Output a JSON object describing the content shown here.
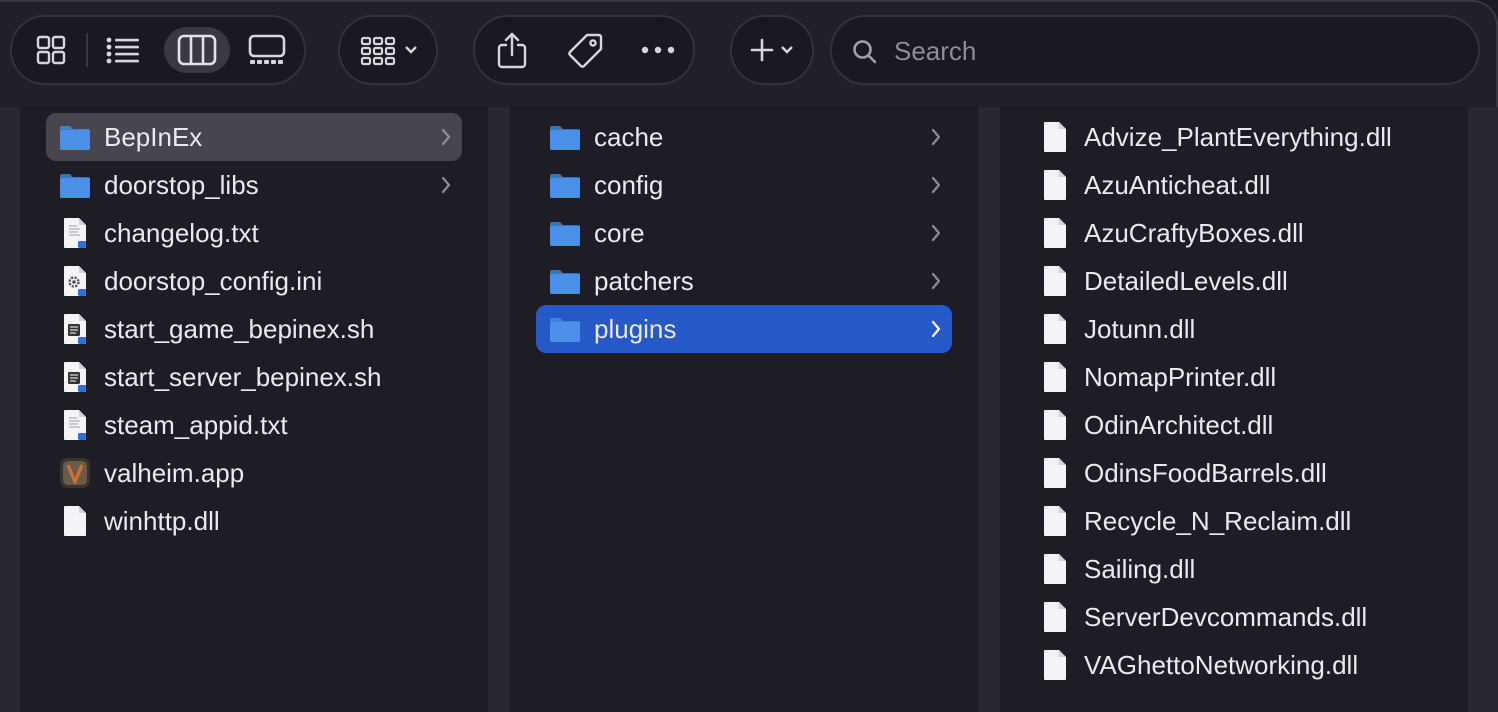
{
  "toolbar": {
    "view_buttons": [
      {
        "name": "icon-view",
        "icon": "grid-icon",
        "active": false
      },
      {
        "name": "list-view",
        "icon": "list-icon",
        "active": false
      },
      {
        "name": "column-view",
        "icon": "columns-icon",
        "active": true
      },
      {
        "name": "gallery-view",
        "icon": "gallery-icon",
        "active": false
      }
    ],
    "group_button": {
      "icon": "group-grid-icon",
      "chevron": "chevron-down-icon"
    },
    "action_buttons": [
      "share-icon",
      "tag-icon",
      "more-icon"
    ],
    "add_button": {
      "icon": "plus-icon",
      "chevron": "chevron-down-icon"
    },
    "search": {
      "placeholder": "Search",
      "value": ""
    }
  },
  "columns": [
    {
      "items": [
        {
          "label": "BepInEx",
          "kind": "folder",
          "has_children": true,
          "selected": "gray"
        },
        {
          "label": "doorstop_libs",
          "kind": "folder",
          "has_children": true,
          "selected": ""
        },
        {
          "label": "changelog.txt",
          "kind": "text-file",
          "has_children": false,
          "selected": ""
        },
        {
          "label": "doorstop_config.ini",
          "kind": "config-file",
          "has_children": false,
          "selected": ""
        },
        {
          "label": "start_game_bepinex.sh",
          "kind": "script-file",
          "has_children": false,
          "selected": ""
        },
        {
          "label": "start_server_bepinex.sh",
          "kind": "script-file",
          "has_children": false,
          "selected": ""
        },
        {
          "label": "steam_appid.txt",
          "kind": "text-file",
          "has_children": false,
          "selected": ""
        },
        {
          "label": "valheim.app",
          "kind": "app",
          "has_children": false,
          "selected": ""
        },
        {
          "label": "winhttp.dll",
          "kind": "blank-file",
          "has_children": false,
          "selected": ""
        }
      ]
    },
    {
      "items": [
        {
          "label": "cache",
          "kind": "folder",
          "has_children": true,
          "selected": ""
        },
        {
          "label": "config",
          "kind": "folder",
          "has_children": true,
          "selected": ""
        },
        {
          "label": "core",
          "kind": "folder",
          "has_children": true,
          "selected": ""
        },
        {
          "label": "patchers",
          "kind": "folder",
          "has_children": true,
          "selected": ""
        },
        {
          "label": "plugins",
          "kind": "folder",
          "has_children": true,
          "selected": "blue"
        }
      ]
    },
    {
      "items": [
        {
          "label": "Advize_PlantEverything.dll",
          "kind": "blank-file",
          "has_children": false,
          "selected": ""
        },
        {
          "label": "AzuAnticheat.dll",
          "kind": "blank-file",
          "has_children": false,
          "selected": ""
        },
        {
          "label": "AzuCraftyBoxes.dll",
          "kind": "blank-file",
          "has_children": false,
          "selected": ""
        },
        {
          "label": "DetailedLevels.dll",
          "kind": "blank-file",
          "has_children": false,
          "selected": ""
        },
        {
          "label": "Jotunn.dll",
          "kind": "blank-file",
          "has_children": false,
          "selected": ""
        },
        {
          "label": "NomapPrinter.dll",
          "kind": "blank-file",
          "has_children": false,
          "selected": ""
        },
        {
          "label": "OdinArchitect.dll",
          "kind": "blank-file",
          "has_children": false,
          "selected": ""
        },
        {
          "label": "OdinsFoodBarrels.dll",
          "kind": "blank-file",
          "has_children": false,
          "selected": ""
        },
        {
          "label": "Recycle_N_Reclaim.dll",
          "kind": "blank-file",
          "has_children": false,
          "selected": ""
        },
        {
          "label": "Sailing.dll",
          "kind": "blank-file",
          "has_children": false,
          "selected": ""
        },
        {
          "label": "ServerDevcommands.dll",
          "kind": "blank-file",
          "has_children": false,
          "selected": ""
        },
        {
          "label": "VAGhettoNetworking.dll",
          "kind": "blank-file",
          "has_children": false,
          "selected": ""
        }
      ]
    }
  ],
  "colors": {
    "folder": "#4a90e8",
    "selection_active": "#2559c8",
    "selection_inactive": "#48454e",
    "background": "#1e1c24"
  }
}
